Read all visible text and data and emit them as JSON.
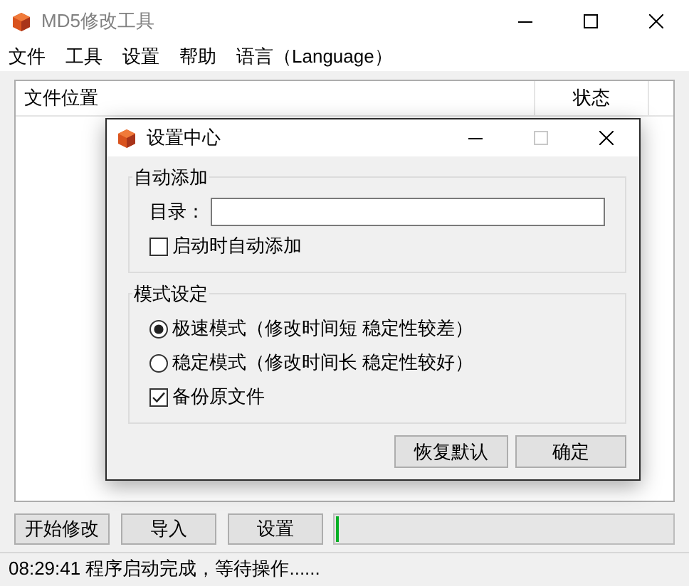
{
  "window": {
    "title": "MD5修改工具"
  },
  "menu": [
    "文件",
    "工具",
    "设置",
    "帮助",
    "语言（Language）"
  ],
  "table": {
    "columns": [
      "文件位置",
      "状态"
    ]
  },
  "buttons": [
    "开始修改",
    "导入",
    "设置"
  ],
  "progress": {
    "level": 0.01
  },
  "status_bar": "08:29:41 程序启动完成，等待操作......",
  "dialog": {
    "title": "设置中心",
    "maximize_disabled": true,
    "groups": [
      {
        "title": "自动添加",
        "items": [
          {
            "kind": "field",
            "label": "目录："
          },
          {
            "kind": "checkbox",
            "label": "启动时自动添加",
            "checked": false
          }
        ]
      },
      {
        "title": "模式设定",
        "items": [
          {
            "kind": "radio",
            "label": "极速模式（修改时间短 稳定性较差）",
            "selected": true
          },
          {
            "kind": "radio",
            "label": "稳定模式（修改时间长 稳定性较好）",
            "selected": false
          },
          {
            "kind": "checkbox",
            "label": "备份原文件",
            "checked": true
          }
        ]
      }
    ],
    "buttons": [
      "恢复默认",
      "确定"
    ]
  }
}
